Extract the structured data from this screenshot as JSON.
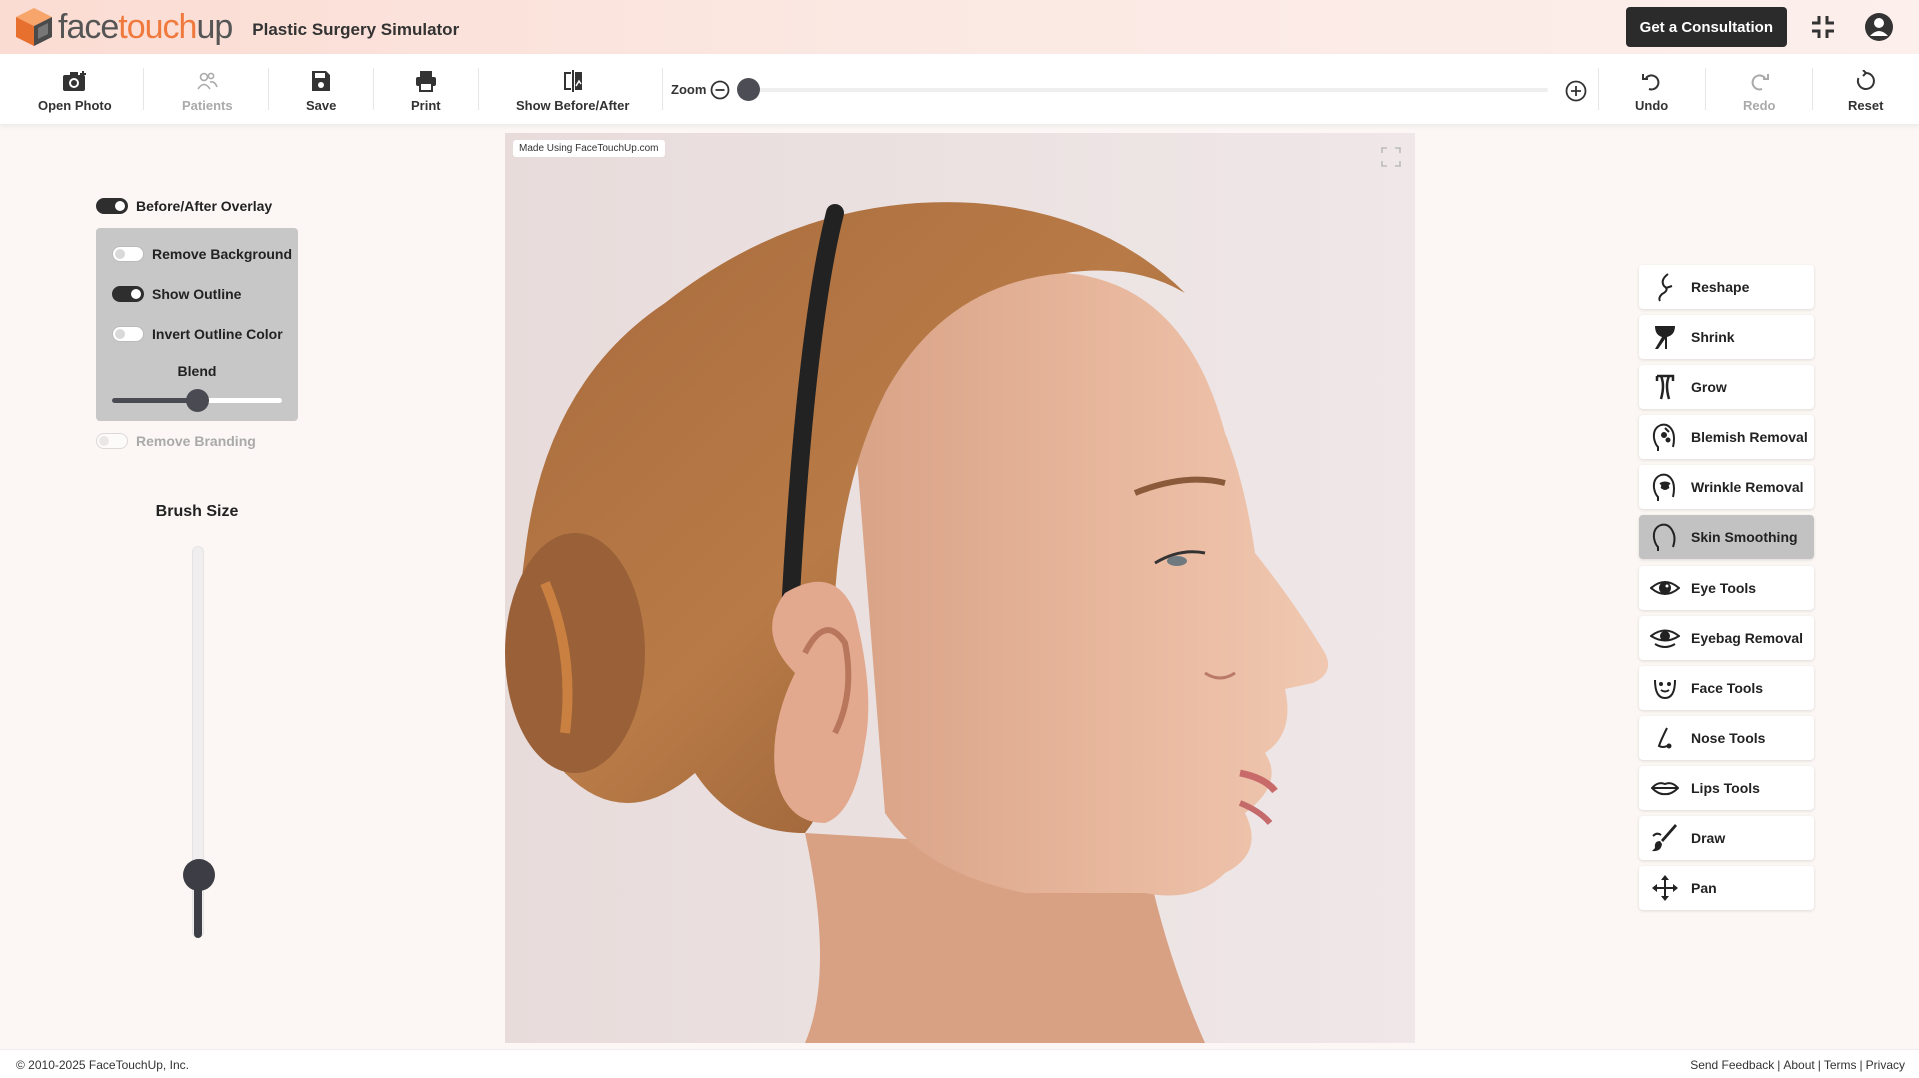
{
  "header": {
    "logo_part1": "face",
    "logo_part2": "touch",
    "logo_part3": "up",
    "app_title": "Plastic Surgery Simulator",
    "consult_label": "Get a Consultation",
    "brand_accent": "#f07a3d"
  },
  "toolbar": {
    "open_photo": "Open Photo",
    "patients": "Patients",
    "save": "Save",
    "print": "Print",
    "show_before_after": "Show Before/After",
    "zoom_label": "Zoom",
    "zoom_value": 0.0,
    "undo": "Undo",
    "redo": "Redo",
    "reset": "Reset"
  },
  "left_panel": {
    "before_after_overlay": {
      "label": "Before/After Overlay",
      "on": true
    },
    "remove_background": {
      "label": "Remove Background",
      "on": false
    },
    "show_outline": {
      "label": "Show Outline",
      "on": true
    },
    "invert_outline_color": {
      "label": "Invert Outline Color",
      "on": false
    },
    "blend_label": "Blend",
    "blend_value": 0.5,
    "remove_branding": {
      "label": "Remove Branding",
      "on": false,
      "disabled": true
    },
    "brush_size_label": "Brush Size",
    "brush_size_value": 0.13
  },
  "canvas": {
    "watermark": "Made Using FaceTouchUp.com"
  },
  "tools": [
    {
      "label": "Reshape",
      "icon": "reshape-icon",
      "active": false
    },
    {
      "label": "Shrink",
      "icon": "shrink-icon",
      "active": false
    },
    {
      "label": "Grow",
      "icon": "grow-icon",
      "active": false
    },
    {
      "label": "Blemish Removal",
      "icon": "blemish-icon",
      "active": false
    },
    {
      "label": "Wrinkle Removal",
      "icon": "wrinkle-icon",
      "active": false
    },
    {
      "label": "Skin Smoothing",
      "icon": "skin-smoothing-icon",
      "active": true
    },
    {
      "label": "Eye Tools",
      "icon": "eye-icon",
      "active": false
    },
    {
      "label": "Eyebag Removal",
      "icon": "eyebag-icon",
      "active": false
    },
    {
      "label": "Face Tools",
      "icon": "face-icon",
      "active": false
    },
    {
      "label": "Nose Tools",
      "icon": "nose-icon",
      "active": false
    },
    {
      "label": "Lips Tools",
      "icon": "lips-icon",
      "active": false
    },
    {
      "label": "Draw",
      "icon": "draw-icon",
      "active": false
    },
    {
      "label": "Pan",
      "icon": "pan-icon",
      "active": false
    }
  ],
  "footer": {
    "copyright": "© 2010-2025 FaceTouchUp, Inc.",
    "links": [
      "Send Feedback",
      "About",
      "Terms",
      "Privacy"
    ]
  }
}
